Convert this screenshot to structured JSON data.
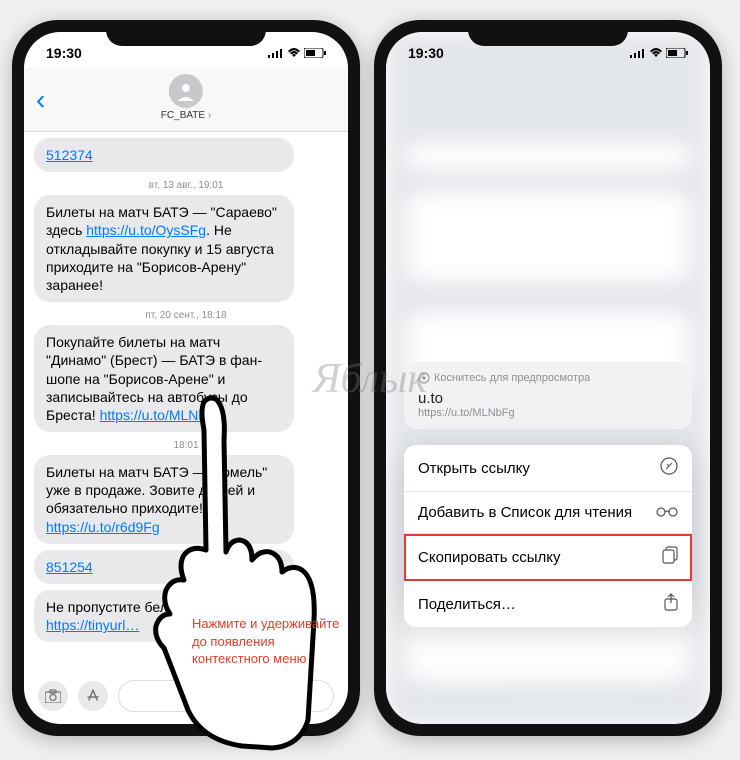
{
  "status": {
    "time": "19:30"
  },
  "watermark": "Яблык",
  "left": {
    "contact": "FC_BATE",
    "messages": [
      {
        "type": "link",
        "text": "512374"
      },
      {
        "type": "ts",
        "text": "вт, 13 авг., 19:01"
      },
      {
        "type": "msg",
        "pre": "Билеты на матч БАТЭ — \"Сараево\" здесь ",
        "link": "https://u.to/OysSFg",
        "post": ". Не откладывайте покупку и 15 августа приходите на \"Борисов-Арену\" заранее!"
      },
      {
        "type": "ts",
        "text": "пт, 20 сент., 18:18"
      },
      {
        "type": "msg",
        "pre": "Покупайте билеты на матч \"Динамо\" (Брест) — БАТЭ в фан-шопе на \"Борисов-Арене\" и записывайтесь на автобусы до Бреста! ",
        "link": "https://u.to/MLNbFg",
        "post": ""
      },
      {
        "type": "ts",
        "text": "18:01"
      },
      {
        "type": "msg",
        "pre": "Билеты на матч БАТЭ — \"Гомель\" уже в продаже. Зовите друзей и обязательно приходите! ",
        "link": "https://u.to/r6d9Fg",
        "post": ""
      },
      {
        "type": "link",
        "text": "851254"
      },
      {
        "type": "msg",
        "pre": "Не пропустите белорусское \"…\" ",
        "link": "https://tinyurl…",
        "post": ""
      }
    ],
    "instruction": "Нажмите и удерживайте до появления контекстного меню"
  },
  "right": {
    "preview": {
      "hint": "Коснитесь для предпросмотра",
      "title": "u.to",
      "url": "https://u.to/MLNbFg"
    },
    "menu": [
      {
        "label": "Открыть ссылку",
        "icon": "compass",
        "hl": false
      },
      {
        "label": "Добавить в Список для чтения",
        "icon": "glasses",
        "hl": false
      },
      {
        "label": "Скопировать ссылку",
        "icon": "copy",
        "hl": true
      },
      {
        "label": "Поделиться…",
        "icon": "share",
        "hl": false
      }
    ]
  }
}
